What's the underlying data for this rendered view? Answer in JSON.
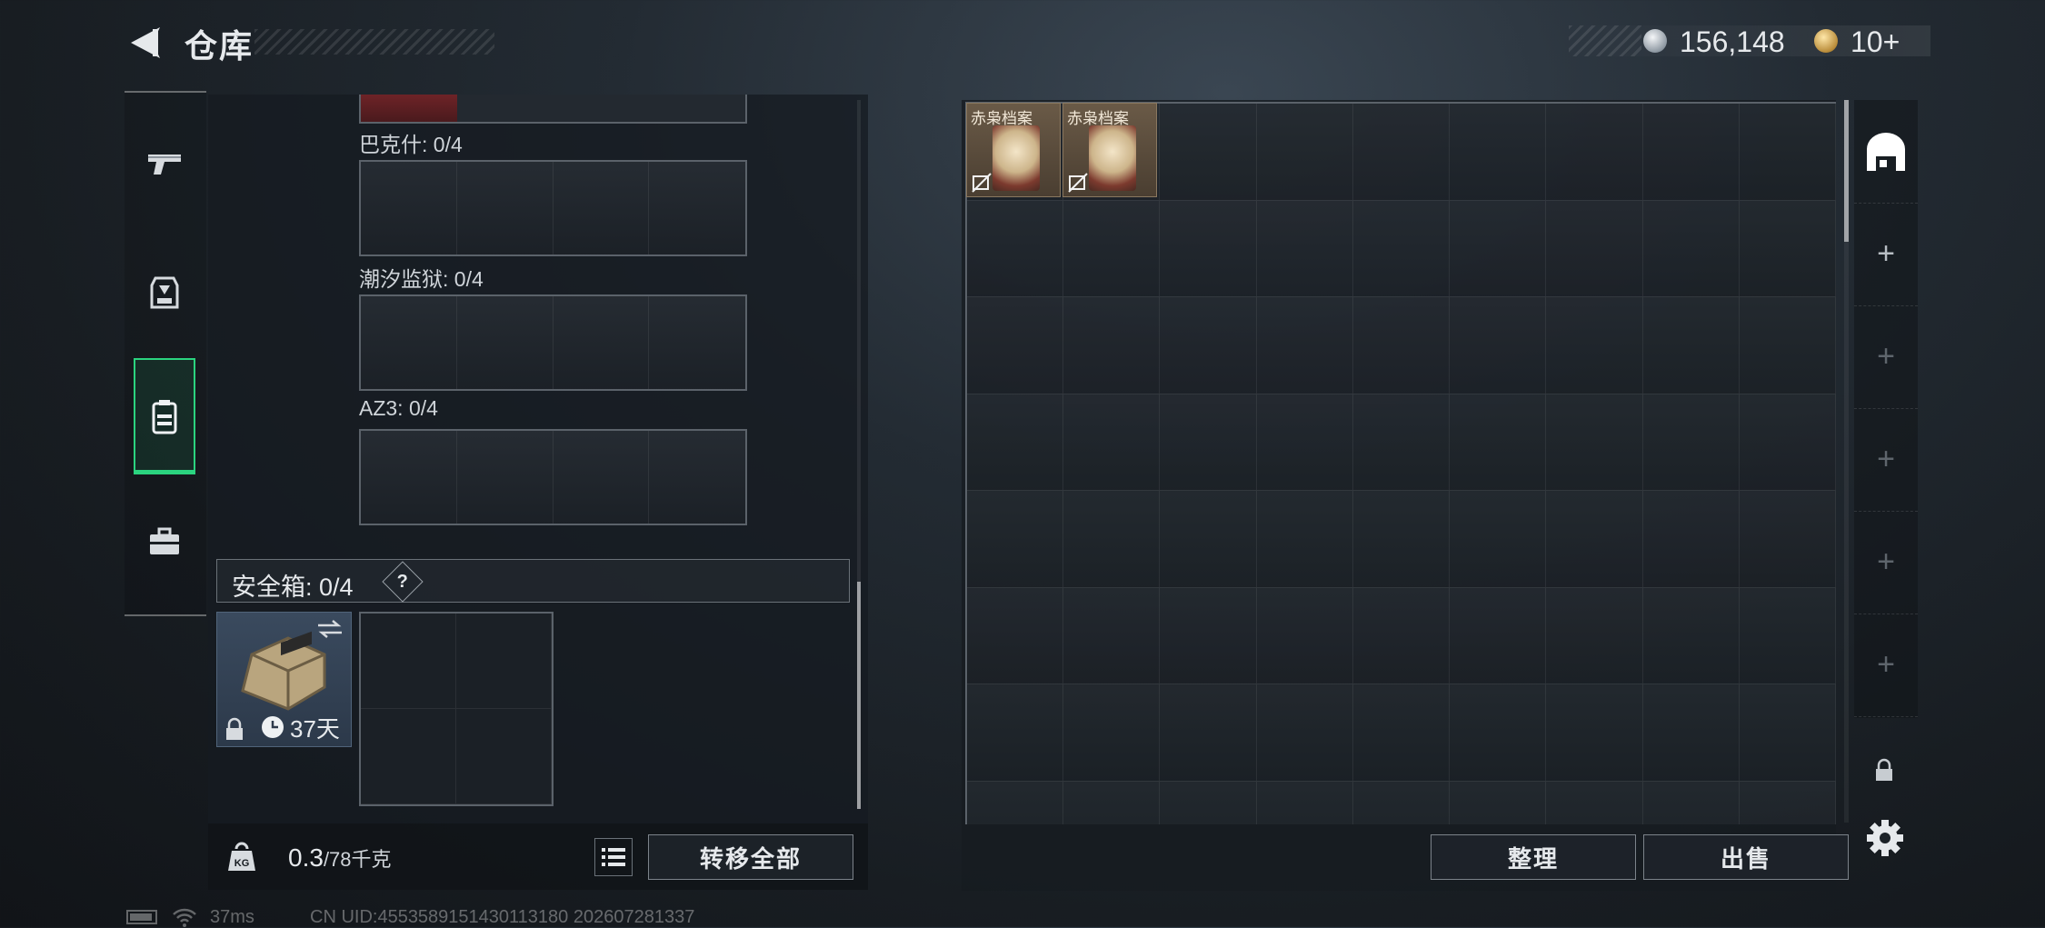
{
  "header": {
    "title": "仓库",
    "currency": {
      "silver_amount": "156,148",
      "gold_amount": "10+"
    }
  },
  "category_tabs": [
    {
      "icon": "pistol-icon",
      "active": false
    },
    {
      "icon": "armor-icon",
      "active": false
    },
    {
      "icon": "backpack-icon",
      "active": true
    },
    {
      "icon": "briefcase-icon",
      "active": false
    }
  ],
  "equipment_slots": [
    {
      "label": "巴克什: 0/4"
    },
    {
      "label": "潮汐监狱: 0/4"
    },
    {
      "label": "AZ3: 0/4"
    }
  ],
  "safebox": {
    "label": "安全箱:  0/4",
    "help": "?",
    "expiry": "37天"
  },
  "weight": {
    "current": "0.3",
    "max": "/78千克"
  },
  "buttons": {
    "transfer_all": "转移全部",
    "sort": "整理",
    "sell": "出售"
  },
  "stash_items": [
    {
      "name": "赤枭档案"
    },
    {
      "name": "赤枭档案"
    }
  ],
  "status_bar": {
    "ping": "37ms",
    "uid": "CN UID:4553589151430113180 202607281337"
  }
}
